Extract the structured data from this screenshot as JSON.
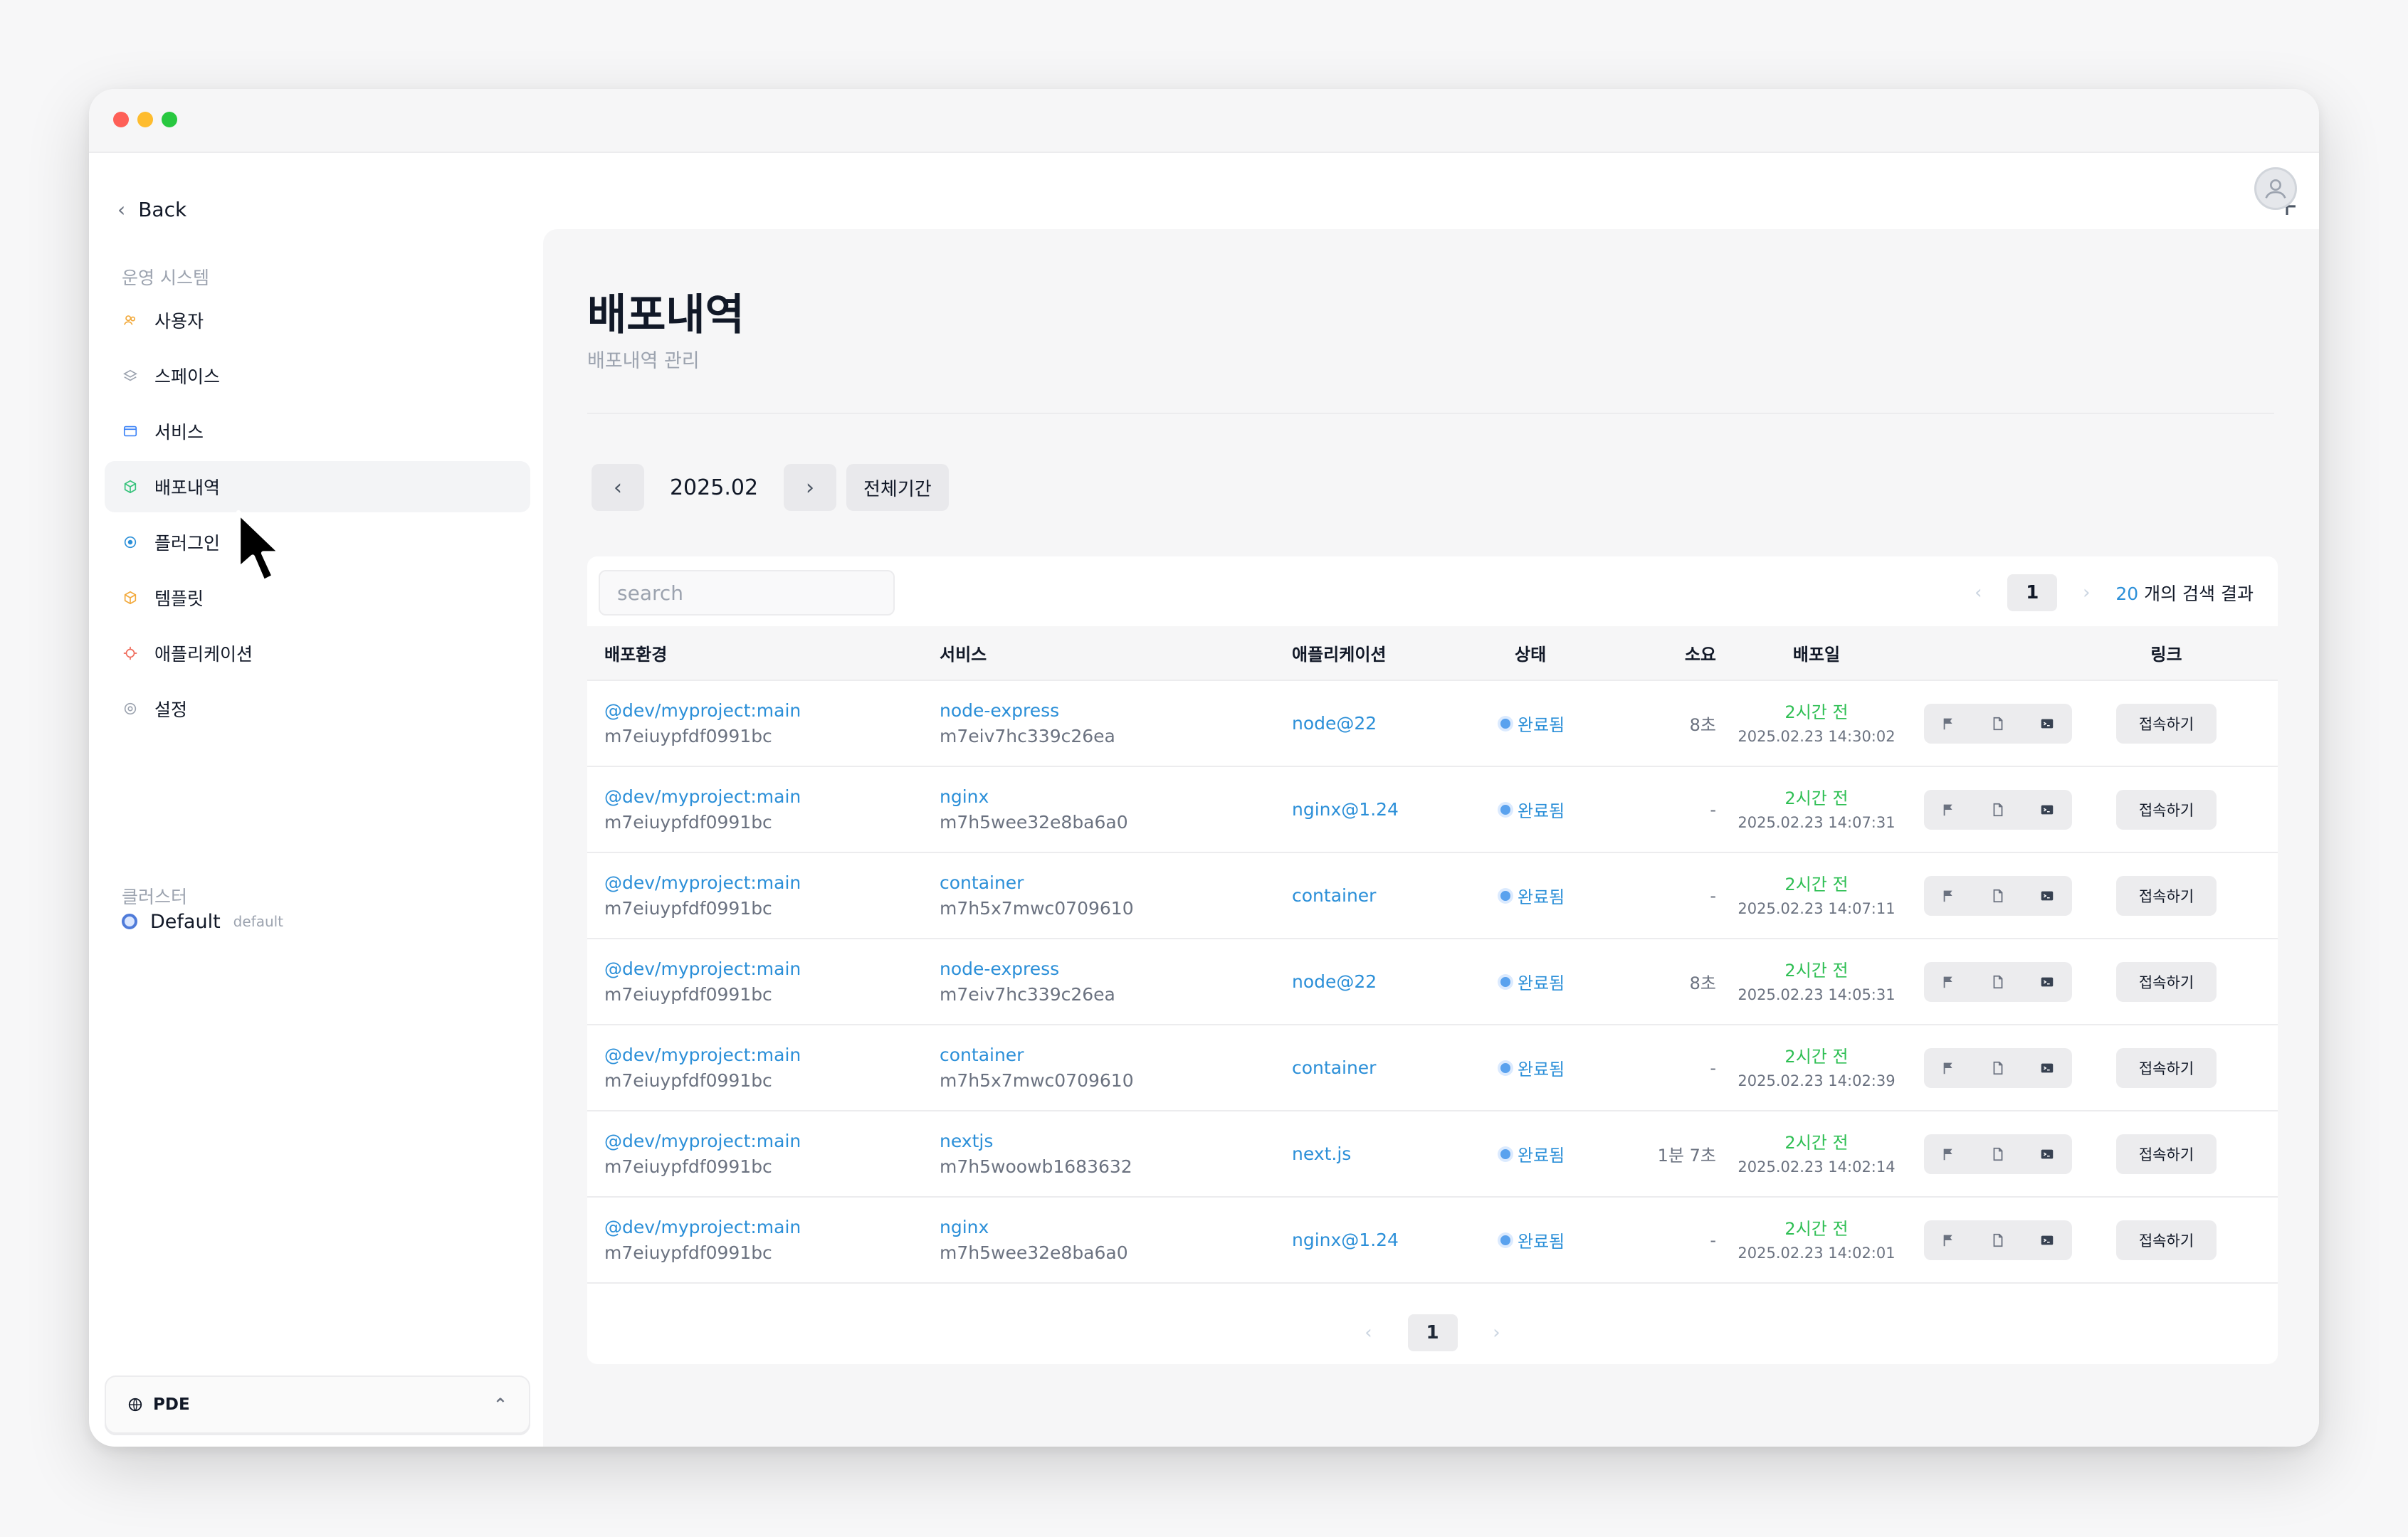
{
  "window": {
    "colors": {
      "red": "#fe5f57",
      "yellow": "#febc2e",
      "green": "#28c840"
    }
  },
  "header": {
    "plus_icon": "+"
  },
  "sidebar": {
    "back_label": "Back",
    "section1_label": "운영 시스템",
    "items": [
      {
        "label": "사용자",
        "icon": "users-icon"
      },
      {
        "label": "스페이스",
        "icon": "layers-icon"
      },
      {
        "label": "서비스",
        "icon": "window-icon"
      },
      {
        "label": "배포내역",
        "icon": "package-icon",
        "active": true
      },
      {
        "label": "플러그인",
        "icon": "plugin-icon"
      },
      {
        "label": "템플릿",
        "icon": "template-icon"
      },
      {
        "label": "애플리케이션",
        "icon": "app-icon"
      },
      {
        "label": "설정",
        "icon": "settings-icon"
      }
    ],
    "section2_label": "클러스터",
    "cluster": {
      "name": "Default",
      "tag": "default"
    },
    "workspace": {
      "label": "PDE"
    }
  },
  "main": {
    "title": "배포내역",
    "subtitle": "배포내역 관리",
    "month": "2025.02",
    "all_period": "전체기간",
    "search_placeholder": "search",
    "page": "1",
    "result_count": "20",
    "result_text": "개의 검색 결과",
    "columns": [
      "배포환경",
      "서비스",
      "애플리케이션",
      "상태",
      "소요",
      "배포일",
      "링크"
    ],
    "rows": [
      {
        "env": "@dev/myproject:main",
        "env_id": "m7eiuypfdf0991bc",
        "service": "node-express",
        "service_id": "m7eiv7hc339c26ea",
        "app": "node@22",
        "status": "완료됨",
        "duration": "8초",
        "rel": "2시간 전",
        "date": "2025.02.23 14:30:02",
        "link": "접속하기"
      },
      {
        "env": "@dev/myproject:main",
        "env_id": "m7eiuypfdf0991bc",
        "service": "nginx",
        "service_id": "m7h5wee32e8ba6a0",
        "app": "nginx@1.24",
        "status": "완료됨",
        "duration": "-",
        "rel": "2시간 전",
        "date": "2025.02.23 14:07:31",
        "link": "접속하기"
      },
      {
        "env": "@dev/myproject:main",
        "env_id": "m7eiuypfdf0991bc",
        "service": "container",
        "service_id": "m7h5x7mwc0709610",
        "app": "container",
        "status": "완료됨",
        "duration": "-",
        "rel": "2시간 전",
        "date": "2025.02.23 14:07:11",
        "link": "접속하기"
      },
      {
        "env": "@dev/myproject:main",
        "env_id": "m7eiuypfdf0991bc",
        "service": "node-express",
        "service_id": "m7eiv7hc339c26ea",
        "app": "node@22",
        "status": "완료됨",
        "duration": "8초",
        "rel": "2시간 전",
        "date": "2025.02.23 14:05:31",
        "link": "접속하기"
      },
      {
        "env": "@dev/myproject:main",
        "env_id": "m7eiuypfdf0991bc",
        "service": "container",
        "service_id": "m7h5x7mwc0709610",
        "app": "container",
        "status": "완료됨",
        "duration": "-",
        "rel": "2시간 전",
        "date": "2025.02.23 14:02:39",
        "link": "접속하기"
      },
      {
        "env": "@dev/myproject:main",
        "env_id": "m7eiuypfdf0991bc",
        "service": "nextjs",
        "service_id": "m7h5woowb1683632",
        "app": "next.js",
        "status": "완료됨",
        "duration": "1분 7초",
        "rel": "2시간 전",
        "date": "2025.02.23 14:02:14",
        "link": "접속하기"
      },
      {
        "env": "@dev/myproject:main",
        "env_id": "m7eiuypfdf0991bc",
        "service": "nginx",
        "service_id": "m7h5wee32e8ba6a0",
        "app": "nginx@1.24",
        "status": "완료됨",
        "duration": "-",
        "rel": "2시간 전",
        "date": "2025.02.23 14:02:01",
        "link": "접속하기"
      }
    ]
  }
}
